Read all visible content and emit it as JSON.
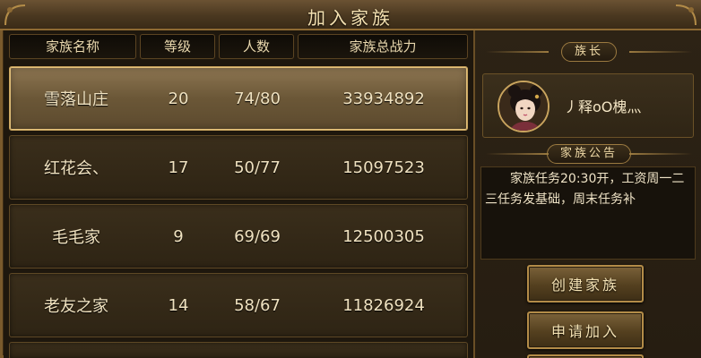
{
  "window": {
    "title": "加入家族"
  },
  "table": {
    "headers": {
      "name": "家族名称",
      "level": "等级",
      "members": "人数",
      "power": "家族总战力"
    },
    "rows": [
      {
        "name": "雪落山庄",
        "level": "20",
        "members": "74/80",
        "power": "33934892",
        "selected": true
      },
      {
        "name": "红花会、",
        "level": "17",
        "members": "50/77",
        "power": "15097523",
        "selected": false
      },
      {
        "name": "毛毛家",
        "level": "9",
        "members": "69/69",
        "power": "12500305",
        "selected": false
      },
      {
        "name": "老友之家",
        "level": "14",
        "members": "58/67",
        "power": "11826924",
        "selected": false
      }
    ]
  },
  "leader": {
    "label": "族长",
    "name": "丿释oO槐灬"
  },
  "announcement": {
    "label": "家族公告",
    "text": "家族任务20:30开，工资周一二三任务发基础，周末任务补"
  },
  "buttons": {
    "create": "创建家族",
    "apply": "申请加入"
  },
  "colors": {
    "accent_gold": "#c9a45e",
    "text_light": "#f0e2c0",
    "panel_dark": "#1e170d"
  }
}
